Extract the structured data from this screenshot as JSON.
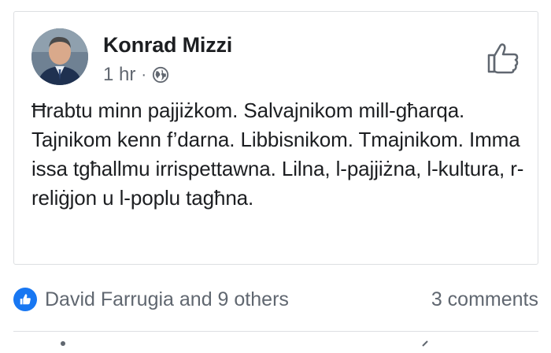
{
  "post": {
    "author": "Konrad Mizzi",
    "time": "1 hr",
    "separator": "·",
    "visibility_icon": "globe-icon",
    "text": "Ħrabtu minn pajjiżkom. Salvajnikom mill-għarqa. Tajnikom kenn f’darna. Libbisnikom. Tmajnikom. Imma issa tgħallmu irrispettawna. Lilna, l-pajjiżna, l-kultura, r-reliġjon u l-poplu tagħna."
  },
  "reactions": {
    "icon": "like-icon",
    "summary": "David Farrugia and 9 others",
    "comments": "3 comments"
  },
  "colors": {
    "accent": "#1877f2",
    "text": "#1c1e21",
    "secondary": "#616770",
    "border": "#dddfe2"
  }
}
